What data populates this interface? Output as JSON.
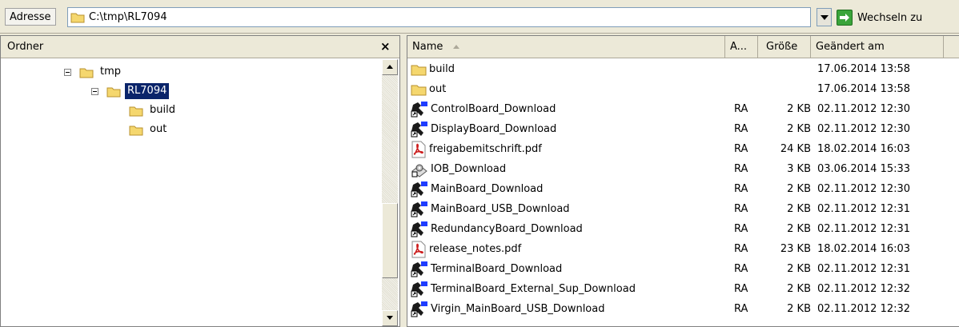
{
  "address": {
    "label": "Adresse",
    "path": "C:\\tmp\\RL7094",
    "go_label": "Wechseln zu"
  },
  "folders_pane": {
    "title": "Ordner",
    "close": "×",
    "tree": [
      {
        "label": "tmp",
        "level": 0,
        "expanded": true,
        "selected": false
      },
      {
        "label": "RL7094",
        "level": 1,
        "expanded": true,
        "selected": true
      },
      {
        "label": "build",
        "level": 2,
        "expanded": false,
        "selected": false
      },
      {
        "label": "out",
        "level": 2,
        "expanded": false,
        "selected": false
      }
    ]
  },
  "file_list": {
    "columns": {
      "name": "Name",
      "attr": "A...",
      "size": "Größe",
      "modified": "Geändert am"
    },
    "rows": [
      {
        "icon": "folder-icon",
        "name": "build",
        "attr": "",
        "size": "",
        "modified": "17.06.2014 13:58"
      },
      {
        "icon": "folder-icon",
        "name": "out",
        "attr": "",
        "size": "",
        "modified": "17.06.2014 13:58"
      },
      {
        "icon": "shortcut-icon",
        "name": "ControlBoard_Download",
        "attr": "RA",
        "size": "2 KB",
        "modified": "02.11.2012 12:30"
      },
      {
        "icon": "shortcut-icon",
        "name": "DisplayBoard_Download",
        "attr": "RA",
        "size": "2 KB",
        "modified": "02.11.2012 12:30"
      },
      {
        "icon": "pdf-icon",
        "name": "freigabemitschrift.pdf",
        "attr": "RA",
        "size": "24 KB",
        "modified": "18.02.2014 16:03"
      },
      {
        "icon": "batch-icon",
        "name": "IOB_Download",
        "attr": "RA",
        "size": "3 KB",
        "modified": "03.06.2014 15:33"
      },
      {
        "icon": "shortcut-icon",
        "name": "MainBoard_Download",
        "attr": "RA",
        "size": "2 KB",
        "modified": "02.11.2012 12:30"
      },
      {
        "icon": "shortcut-icon",
        "name": "MainBoard_USB_Download",
        "attr": "RA",
        "size": "2 KB",
        "modified": "02.11.2012 12:31"
      },
      {
        "icon": "shortcut-icon",
        "name": "RedundancyBoard_Download",
        "attr": "RA",
        "size": "2 KB",
        "modified": "02.11.2012 12:31"
      },
      {
        "icon": "pdf-icon",
        "name": "release_notes.pdf",
        "attr": "RA",
        "size": "23 KB",
        "modified": "18.02.2014 16:03"
      },
      {
        "icon": "shortcut-icon",
        "name": "TerminalBoard_Download",
        "attr": "RA",
        "size": "2 KB",
        "modified": "02.11.2012 12:31"
      },
      {
        "icon": "shortcut-icon",
        "name": "TerminalBoard_External_Sup_Download",
        "attr": "RA",
        "size": "2 KB",
        "modified": "02.11.2012 12:32"
      },
      {
        "icon": "shortcut-icon",
        "name": "Virgin_MainBoard_USB_Download",
        "attr": "RA",
        "size": "2 KB",
        "modified": "02.11.2012 12:32"
      }
    ]
  },
  "colors": {
    "selection": "#0a246a",
    "folder": "#f5d76e",
    "chrome": "#ece9d8",
    "pdf": "#cc1f1f"
  }
}
